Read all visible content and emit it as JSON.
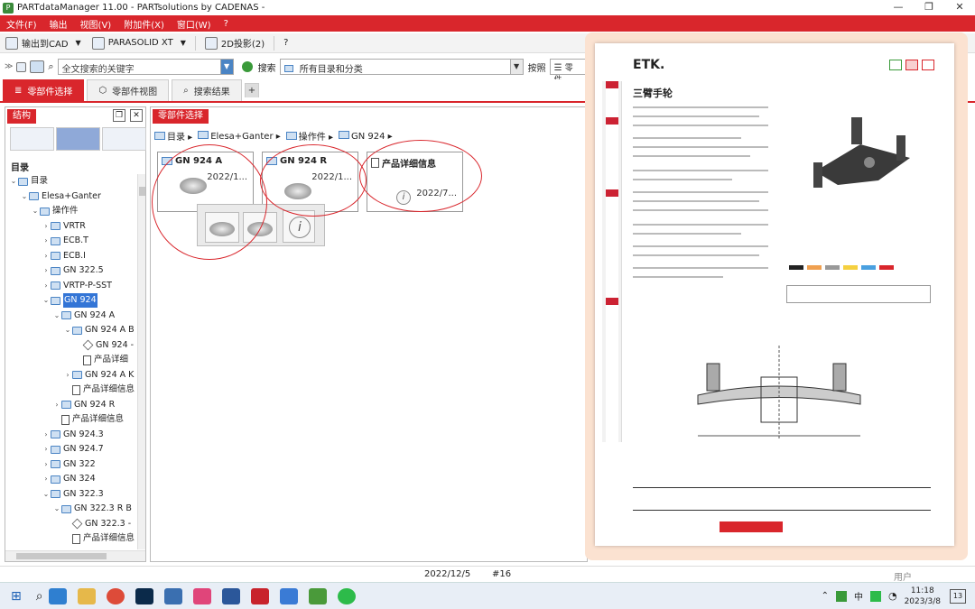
{
  "window": {
    "title": "PARTdataManager 11.00 - PARTsolutions by CADENAS -",
    "controls": [
      "—",
      "❐",
      "✕"
    ]
  },
  "menu": [
    "文件(F)",
    "输出",
    "视图(V)",
    "附加件(X)",
    "窗口(W)",
    "?"
  ],
  "toolbar": {
    "export_cad": "输出到CAD",
    "format": "PARASOLID XT",
    "projection_2d": "2D投影(2)"
  },
  "search": {
    "placeholder": "全文搜索的关键字",
    "search_label": "搜索",
    "catalog_value": "所有目录和分类",
    "sort_label": "按照",
    "extra": "零件"
  },
  "tabs": [
    "零部件选择",
    "零部件视图",
    "搜索结果"
  ],
  "left_panel": {
    "header": "结构",
    "tree_title": "目录",
    "tree": [
      {
        "label": "目录",
        "level": 0,
        "toggle": "v",
        "icon": "folder"
      },
      {
        "label": "Elesa+Ganter",
        "level": 1,
        "toggle": "v",
        "icon": "folder"
      },
      {
        "label": "操作件",
        "level": 2,
        "toggle": "v",
        "icon": "folder"
      },
      {
        "label": "VRTR",
        "level": 3,
        "toggle": ">",
        "icon": "folder"
      },
      {
        "label": "ECB.T",
        "level": 3,
        "toggle": ">",
        "icon": "folder"
      },
      {
        "label": "ECB.I",
        "level": 3,
        "toggle": ">",
        "icon": "folder"
      },
      {
        "label": "GN 322.5",
        "level": 3,
        "toggle": ">",
        "icon": "folder"
      },
      {
        "label": "VRTP-P-SST",
        "level": 3,
        "toggle": ">",
        "icon": "folder"
      },
      {
        "label": "GN 924",
        "level": 3,
        "toggle": "v",
        "icon": "folder",
        "selected": true
      },
      {
        "label": "GN 924 A",
        "level": 4,
        "toggle": "v",
        "icon": "folder"
      },
      {
        "label": "GN 924 A B",
        "level": 5,
        "toggle": "v",
        "icon": "folder"
      },
      {
        "label": "GN 924 -",
        "level": 6,
        "toggle": "",
        "icon": "cube"
      },
      {
        "label": "产品详细",
        "level": 6,
        "toggle": "",
        "icon": "doc"
      },
      {
        "label": "GN 924 A K",
        "level": 5,
        "toggle": ">",
        "icon": "folder"
      },
      {
        "label": "产品详细信息",
        "level": 5,
        "toggle": "",
        "icon": "doc"
      },
      {
        "label": "GN 924 R",
        "level": 4,
        "toggle": ">",
        "icon": "folder"
      },
      {
        "label": "产品详细信息",
        "level": 4,
        "toggle": "",
        "icon": "doc"
      },
      {
        "label": "GN 924.3",
        "level": 3,
        "toggle": ">",
        "icon": "folder"
      },
      {
        "label": "GN 924.7",
        "level": 3,
        "toggle": ">",
        "icon": "folder"
      },
      {
        "label": "GN 322",
        "level": 3,
        "toggle": ">",
        "icon": "folder"
      },
      {
        "label": "GN 324",
        "level": 3,
        "toggle": ">",
        "icon": "folder"
      },
      {
        "label": "GN 322.3",
        "level": 3,
        "toggle": "v",
        "icon": "folder"
      },
      {
        "label": "GN 322.3 R B",
        "level": 4,
        "toggle": "v",
        "icon": "folder"
      },
      {
        "label": "GN 322.3 -",
        "level": 5,
        "toggle": "",
        "icon": "cube"
      },
      {
        "label": "产品详细信息",
        "level": 5,
        "toggle": "",
        "icon": "doc"
      }
    ]
  },
  "main_panel": {
    "header": "零部件选择",
    "breadcrumb": [
      "目录",
      "Elesa+Ganter",
      "操作件",
      "GN 924"
    ],
    "cards": [
      {
        "title": "GN 924 A",
        "date": "2022/1..."
      },
      {
        "title": "GN 924 R",
        "date": "2022/1..."
      },
      {
        "title": "产品详细信息",
        "date": "2022/7..."
      }
    ]
  },
  "status": {
    "date": "2022/12/5",
    "number": "#16",
    "user": "用户"
  },
  "document": {
    "brand": "ETK.",
    "title": "三臂手轮"
  },
  "taskbar": {
    "time": "11:18",
    "date": "2023/3/8",
    "ime": "中",
    "notifications": "13"
  },
  "colors": {
    "accent": "#d9262c",
    "selection": "#3375d6",
    "overlay": "#fbe2d1"
  }
}
